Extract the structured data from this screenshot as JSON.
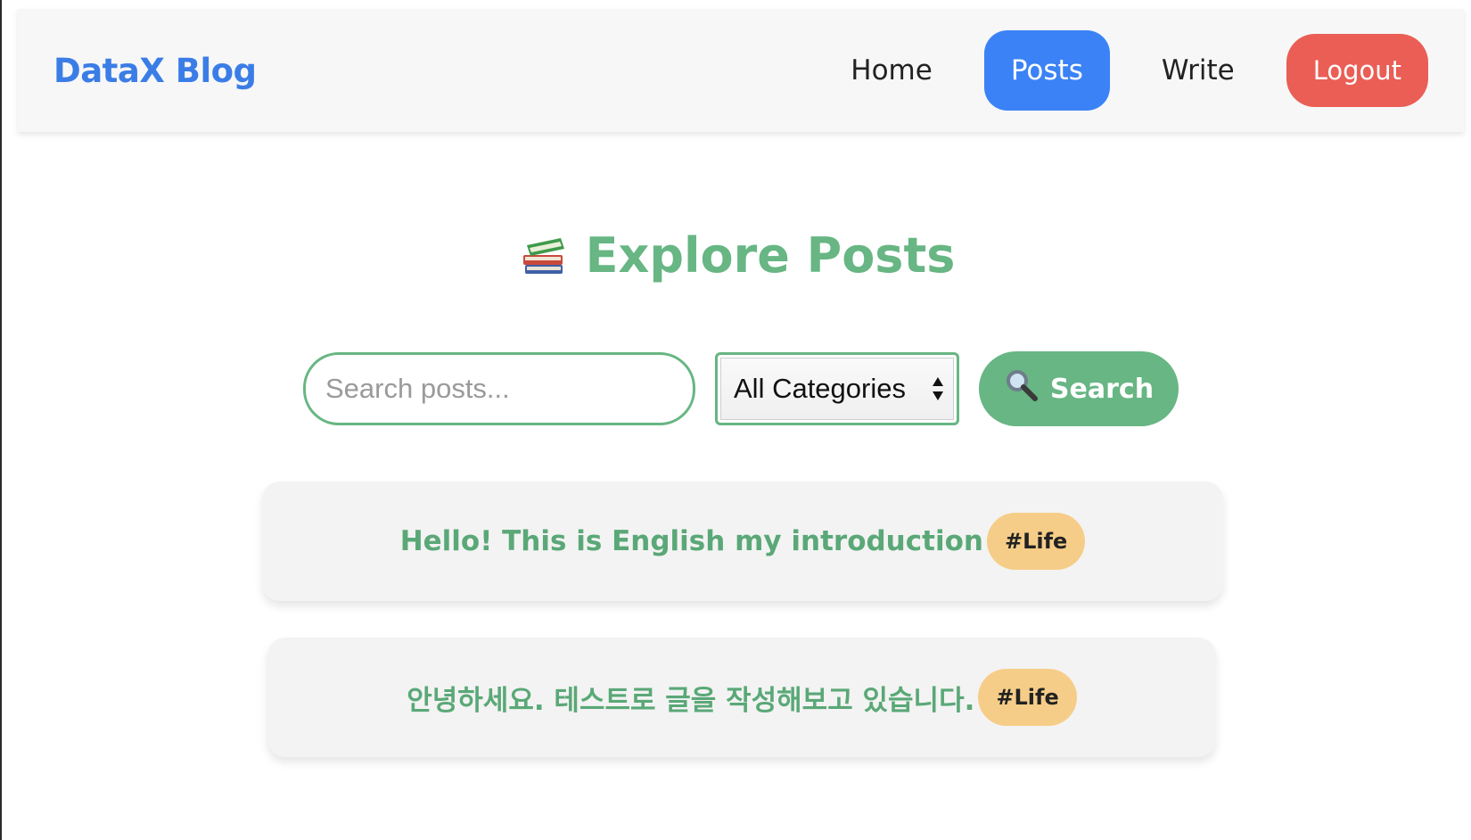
{
  "header": {
    "brand": "DataX Blog",
    "nav": [
      {
        "label": "Home",
        "active": false
      },
      {
        "label": "Posts",
        "active": true
      },
      {
        "label": "Write",
        "active": false
      },
      {
        "label": "Logout",
        "active": false
      }
    ]
  },
  "main": {
    "title": "Explore Posts",
    "title_icon": "books-icon",
    "search": {
      "placeholder": "Search posts...",
      "value": ""
    },
    "category_select": {
      "selected": "All Categories"
    },
    "search_button": {
      "label": "Search",
      "icon": "magnifier-icon"
    },
    "posts": [
      {
        "title": "Hello! This is English my introduction",
        "tag": "#Life"
      },
      {
        "title": "안녕하세요. 테스트로 글을 작성해보고 있습니다.",
        "tag": "#Life"
      }
    ]
  },
  "colors": {
    "brand_blue": "#3b7de6",
    "active_nav": "#3b82f6",
    "logout_red": "#ea5e55",
    "accent_green": "#67b683",
    "tag_yellow": "#f6cd88"
  }
}
